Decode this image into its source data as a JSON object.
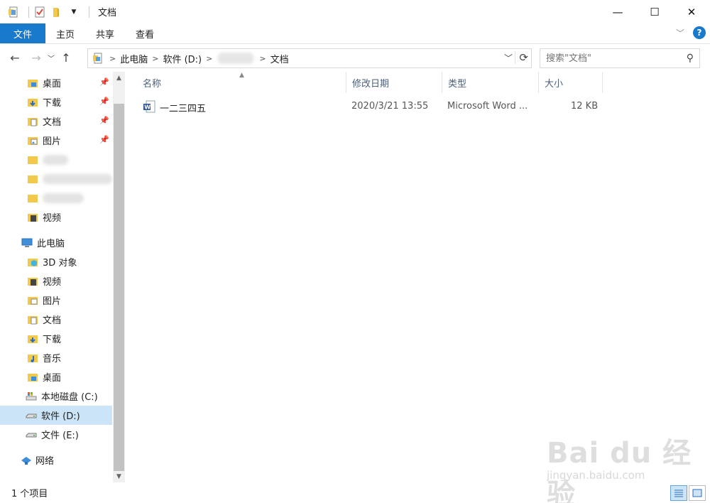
{
  "window": {
    "title": "文档",
    "minimize": "—",
    "maximize": "☐",
    "close": "✕"
  },
  "ribbon": {
    "tabs": [
      "文件",
      "主页",
      "共享",
      "查看"
    ],
    "help": "?"
  },
  "address": {
    "crumbs": [
      "此电脑",
      "软件 (D:)",
      "文档"
    ]
  },
  "search": {
    "placeholder": "搜索\"文档\""
  },
  "sidebar": {
    "quick_access": [
      {
        "label": "桌面",
        "icon": "desktop-folder-icon",
        "pinned": true
      },
      {
        "label": "下载",
        "icon": "downloads-folder-icon",
        "pinned": true
      },
      {
        "label": "文档",
        "icon": "documents-folder-icon",
        "pinned": true
      },
      {
        "label": "图片",
        "icon": "pictures-folder-icon",
        "pinned": true
      },
      {
        "label": "视频",
        "icon": "videos-folder-icon",
        "pinned": false
      }
    ],
    "this_pc": {
      "label": "此电脑"
    },
    "pc_items": [
      {
        "label": "3D 对象",
        "icon": "3d-objects-folder-icon"
      },
      {
        "label": "视频",
        "icon": "videos-folder-icon"
      },
      {
        "label": "图片",
        "icon": "pictures-folder-icon"
      },
      {
        "label": "文档",
        "icon": "documents-folder-icon"
      },
      {
        "label": "下载",
        "icon": "downloads-folder-icon"
      },
      {
        "label": "音乐",
        "icon": "music-folder-icon"
      },
      {
        "label": "桌面",
        "icon": "desktop-folder-icon"
      },
      {
        "label": "本地磁盘 (C:)",
        "icon": "system-drive-icon"
      },
      {
        "label": "软件 (D:)",
        "icon": "drive-icon",
        "selected": true
      },
      {
        "label": "文件 (E:)",
        "icon": "drive-icon"
      }
    ],
    "network": {
      "label": "网络"
    }
  },
  "columns": {
    "name": "名称",
    "date": "修改日期",
    "type": "类型",
    "size": "大小"
  },
  "files": [
    {
      "name": "一二三四五",
      "date": "2020/3/21 13:55",
      "type": "Microsoft Word ...",
      "size": "12 KB"
    }
  ],
  "status": {
    "count": "1 个项目"
  },
  "watermark": {
    "main": "Bai du 经验",
    "sub": "jingyan.baidu.com"
  },
  "colors": {
    "accent": "#1979ca",
    "selected": "#cce4f7",
    "folder": "#f2c94c"
  }
}
